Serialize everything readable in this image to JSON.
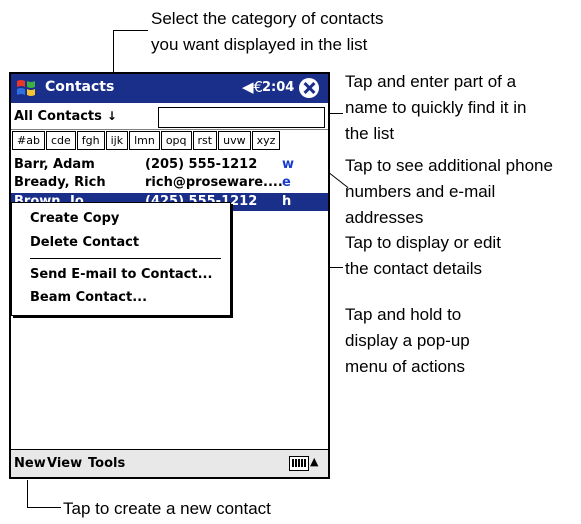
{
  "callouts": {
    "category_1": "Select the category of contacts",
    "category_2": "you want displayed in the list",
    "find_1": "Tap and enter part of a",
    "find_2": "name to quickly find it in",
    "find_3": "the list",
    "additional_1": "Tap to see additional phone",
    "additional_2": "numbers and e-mail",
    "additional_3": "addresses",
    "details_1": "Tap to display or edit",
    "details_2": "the contact details",
    "hold_1": "Tap and hold to",
    "hold_2": "display a pop-up",
    "hold_3": "menu of actions",
    "new_contact": "Tap to create a new contact"
  },
  "titlebar": {
    "title": "Contacts",
    "speaker_icon": "◀€",
    "time": "2:04"
  },
  "category": {
    "label": "All Contacts",
    "arrow": "↓"
  },
  "find": {
    "placeholder": ""
  },
  "abc_tabs": [
    "#ab",
    "cde",
    "fgh",
    "ijk",
    "lmn",
    "opq",
    "rst",
    "uvw",
    "xyz"
  ],
  "contacts": [
    {
      "name": "Barr, Adam",
      "info": "(205) 555-1212",
      "type": "w"
    },
    {
      "name": "Bready, Rich",
      "info": "rich@proseware....",
      "type": "e"
    },
    {
      "name": "Brown, Jo",
      "info": "(425) 555-1212",
      "type": "h"
    }
  ],
  "menu": {
    "create_copy": "Create Copy",
    "delete_contact": "Delete Contact",
    "send_email": "Send E-mail to Contact...",
    "beam_contact": "Beam Contact..."
  },
  "bottom": {
    "new": "New",
    "view": "View",
    "tools": "Tools",
    "up": "▲"
  }
}
